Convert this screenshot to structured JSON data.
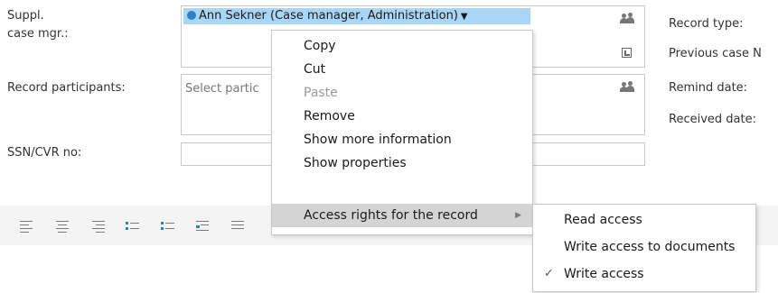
{
  "form": {
    "suppl_label_line1": "Suppl.",
    "suppl_label_line2": "case mgr.:",
    "suppl_chip": "Ann Sekner (Case manager, Administration)",
    "participants_label": "Record participants:",
    "participants_placeholder": "Select partic",
    "ssn_label": "SSN/CVR no:"
  },
  "right_labels": {
    "record_type": "Record type:",
    "previous_case": "Previous case N",
    "remind_date": "Remind date:",
    "received_date": "Received date:"
  },
  "context_menu": {
    "items": [
      {
        "label": "Copy",
        "state": "normal"
      },
      {
        "label": "Cut",
        "state": "normal"
      },
      {
        "label": "Paste",
        "state": "disabled"
      },
      {
        "label": "Remove",
        "state": "normal"
      },
      {
        "label": "Show more information",
        "state": "normal"
      },
      {
        "label": "Show properties",
        "state": "normal"
      },
      {
        "label": "Access rights for the record",
        "state": "highlighted",
        "has_submenu": true
      }
    ]
  },
  "submenu": {
    "items": [
      {
        "label": "Read access",
        "checked": false
      },
      {
        "label": "Write access to documents",
        "checked": false
      },
      {
        "label": "Write access",
        "checked": true
      }
    ]
  },
  "icons": {
    "people": "people-icon",
    "external": "external-link-icon",
    "check": "checkmark-icon",
    "caret": "caret-down-icon"
  },
  "colors": {
    "chip_bg": "#a9d6f5",
    "chip_dot": "#2d7fc9",
    "menu_highlight": "#d4d4d4"
  }
}
